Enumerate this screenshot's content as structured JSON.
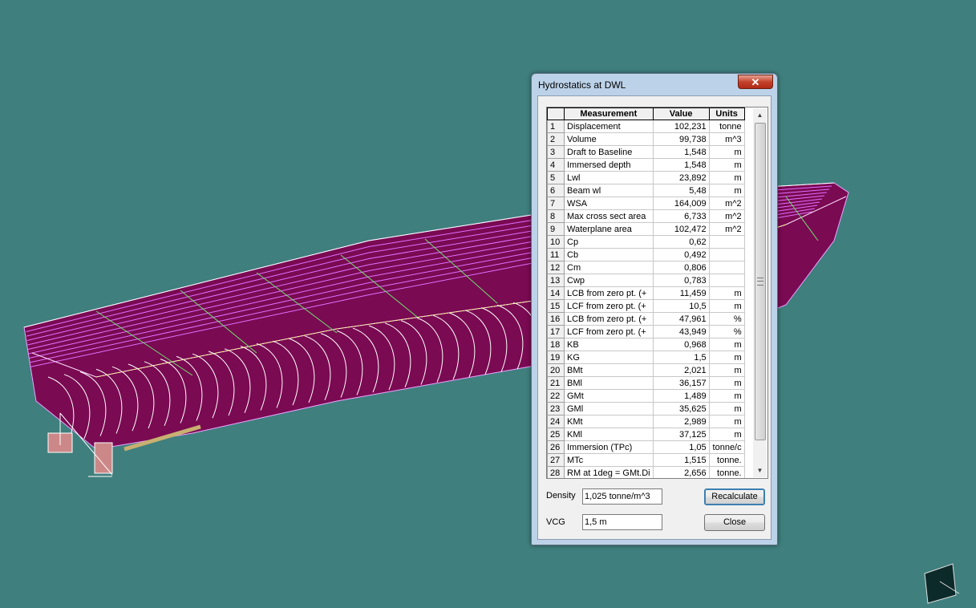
{
  "colors": {
    "background": "#3f7f7e",
    "hull_fill": "#7a0a52",
    "hull_lines": "#e070ff",
    "stations": "#ffffff",
    "highlight": "#ffff66"
  },
  "dialog": {
    "title": "Hydrostatics at DWL",
    "close_glyph": "✕",
    "table": {
      "columns": [
        "Measurement",
        "Value",
        "Units"
      ],
      "rows": [
        {
          "n": "1",
          "m": "Displacement",
          "v": "102,231",
          "u": "tonne"
        },
        {
          "n": "2",
          "m": "Volume",
          "v": "99,738",
          "u": "m^3"
        },
        {
          "n": "3",
          "m": "Draft to Baseline",
          "v": "1,548",
          "u": "m"
        },
        {
          "n": "4",
          "m": "Immersed depth",
          "v": "1,548",
          "u": "m"
        },
        {
          "n": "5",
          "m": "Lwl",
          "v": "23,892",
          "u": "m"
        },
        {
          "n": "6",
          "m": "Beam wl",
          "v": "5,48",
          "u": "m"
        },
        {
          "n": "7",
          "m": "WSA",
          "v": "164,009",
          "u": "m^2"
        },
        {
          "n": "8",
          "m": "Max cross sect area",
          "v": "6,733",
          "u": "m^2"
        },
        {
          "n": "9",
          "m": "Waterplane area",
          "v": "102,472",
          "u": "m^2"
        },
        {
          "n": "10",
          "m": "Cp",
          "v": "0,62",
          "u": ""
        },
        {
          "n": "11",
          "m": "Cb",
          "v": "0,492",
          "u": ""
        },
        {
          "n": "12",
          "m": "Cm",
          "v": "0,806",
          "u": ""
        },
        {
          "n": "13",
          "m": "Cwp",
          "v": "0,783",
          "u": ""
        },
        {
          "n": "14",
          "m": "LCB from zero pt. (+",
          "v": "11,459",
          "u": "m"
        },
        {
          "n": "15",
          "m": "LCF from zero pt. (+",
          "v": "10,5",
          "u": "m"
        },
        {
          "n": "16",
          "m": "LCB from zero pt. (+",
          "v": "47,961",
          "u": "%"
        },
        {
          "n": "17",
          "m": "LCF from zero pt. (+",
          "v": "43,949",
          "u": "%"
        },
        {
          "n": "18",
          "m": "KB",
          "v": "0,968",
          "u": "m"
        },
        {
          "n": "19",
          "m": "KG",
          "v": "1,5",
          "u": "m"
        },
        {
          "n": "20",
          "m": "BMt",
          "v": "2,021",
          "u": "m"
        },
        {
          "n": "21",
          "m": "BMl",
          "v": "36,157",
          "u": "m"
        },
        {
          "n": "22",
          "m": "GMt",
          "v": "1,489",
          "u": "m"
        },
        {
          "n": "23",
          "m": "GMl",
          "v": "35,625",
          "u": "m"
        },
        {
          "n": "24",
          "m": "KMt",
          "v": "2,989",
          "u": "m"
        },
        {
          "n": "25",
          "m": "KMl",
          "v": "37,125",
          "u": "m"
        },
        {
          "n": "26",
          "m": "Immersion (TPc)",
          "v": "1,05",
          "u": "tonne/c"
        },
        {
          "n": "27",
          "m": "MTc",
          "v": "1,515",
          "u": "tonne."
        },
        {
          "n": "28",
          "m": "RM at 1deg = GMt.Di",
          "v": "2,656",
          "u": "tonne."
        }
      ]
    },
    "density_label": "Density",
    "density_value": "1,025 tonne/m^3",
    "vcg_label": "VCG",
    "vcg_value": "1,5 m",
    "recalculate_label": "Recalculate",
    "close_label": "Close"
  }
}
